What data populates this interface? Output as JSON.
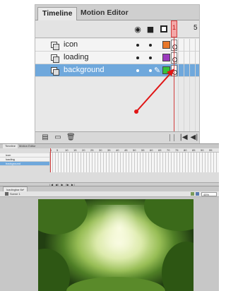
{
  "zoomed_timeline": {
    "tabs": [
      {
        "label": "Timeline",
        "active": true
      },
      {
        "label": "Motion Editor",
        "active": false
      }
    ],
    "header_icons": [
      "eye-icon",
      "lock-icon",
      "outline-icon"
    ],
    "frame_numbers": [
      "1",
      "5"
    ],
    "layers": [
      {
        "name": "icon",
        "color": "#e8772a",
        "selected": false
      },
      {
        "name": "loading",
        "color": "#9b3bbd",
        "selected": false
      },
      {
        "name": "background",
        "color": "#36c23a",
        "selected": true
      }
    ],
    "bottom_icons": [
      "new-layer-icon",
      "new-folder-icon",
      "delete-layer-icon"
    ],
    "playback_controls": [
      "|◀",
      "◀|"
    ]
  },
  "full_timeline": {
    "tabs": [
      {
        "label": "Timeline",
        "active": true
      },
      {
        "label": "Motion Editor",
        "active": false
      }
    ],
    "layers": [
      {
        "name": "icon",
        "selected": false
      },
      {
        "name": "loading",
        "selected": false
      },
      {
        "name": "background",
        "selected": true
      }
    ],
    "frame_numbers": [
      "1",
      "5",
      "10",
      "15",
      "20",
      "25",
      "30",
      "35",
      "40",
      "45",
      "50",
      "55",
      "60",
      "65",
      "70",
      "75",
      "80",
      "85",
      "90",
      "95"
    ],
    "controls": "|◀ ◀| ▶ |▶ ▶|"
  },
  "stage": {
    "doc_tab": "loadingbar.fla*",
    "scene_label": "Scene 1",
    "zoom_value": "45%"
  },
  "colors": {
    "playhead": "#d23c3c",
    "selected_layer": "#6fa8dc",
    "arrow": "#e01515"
  }
}
